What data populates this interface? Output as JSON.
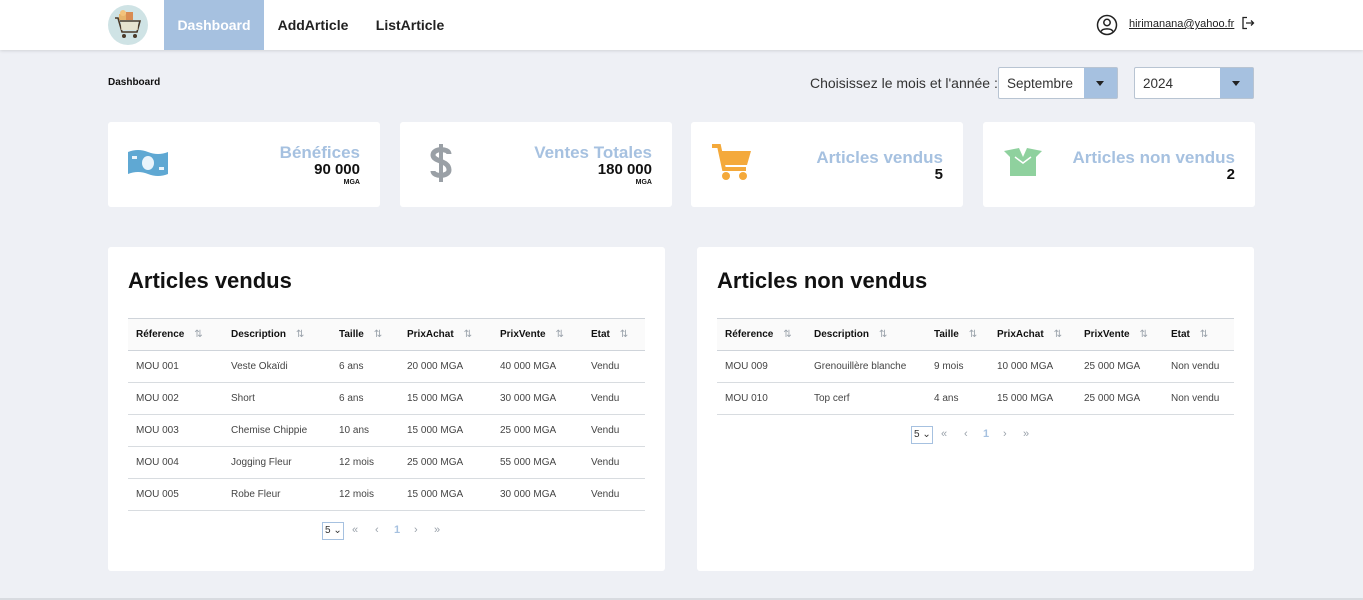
{
  "nav": {
    "items": [
      {
        "label": "Dashboard",
        "active": true
      },
      {
        "label": "AddArticle",
        "active": false
      },
      {
        "label": "ListArticle",
        "active": false
      }
    ],
    "user_email": "hirimanana@yahoo.fr",
    "icons": {
      "user": "user-circle-icon",
      "logout": "logout-icon",
      "logo": "shopping-cart-logo"
    }
  },
  "header": {
    "breadcrumb": "Dashboard",
    "period_label": "Choisissez le mois et l'année :",
    "month": "Septembre",
    "year": "2024"
  },
  "stats": [
    {
      "title": "Bénéfices",
      "value": "90 000",
      "unit": "MGA",
      "icon": "money-bill-icon",
      "icon_color": "#5fa8d3"
    },
    {
      "title": "Ventes Totales",
      "value": "180 000",
      "unit": "MGA",
      "icon": "dollar-icon",
      "icon_color": "#9aa0a6"
    },
    {
      "title": "Articles vendus",
      "value": "5",
      "icon": "shopping-cart-icon",
      "icon_color": "#f4a93b"
    },
    {
      "title": "Articles non vendus",
      "value": "2",
      "icon": "open-box-icon",
      "icon_color": "#8fd19e"
    }
  ],
  "columns": [
    "Réference",
    "Description",
    "Taille",
    "PrixAchat",
    "PrixVente",
    "Etat"
  ],
  "sold": {
    "title": "Articles vendus",
    "rows": [
      [
        "MOU 001",
        "Veste Okaïdi",
        "6 ans",
        "20 000 MGA",
        "40 000 MGA",
        "Vendu"
      ],
      [
        "MOU 002",
        "Short",
        "6 ans",
        "15 000 MGA",
        "30 000 MGA",
        "Vendu"
      ],
      [
        "MOU 003",
        "Chemise Chippie",
        "10 ans",
        "15 000 MGA",
        "25 000 MGA",
        "Vendu"
      ],
      [
        "MOU 004",
        "Jogging Fleur",
        "12 mois",
        "25 000 MGA",
        "55 000 MGA",
        "Vendu"
      ],
      [
        "MOU 005",
        "Robe Fleur",
        "12 mois",
        "15 000 MGA",
        "30 000 MGA",
        "Vendu"
      ]
    ]
  },
  "unsold": {
    "title": "Articles non vendus",
    "rows": [
      [
        "MOU 009",
        "Grenouillère blanche",
        "9 mois",
        "10 000 MGA",
        "25 000 MGA",
        "Non vendu"
      ],
      [
        "MOU 010",
        "Top cerf",
        "4 ans",
        "15 000 MGA",
        "25 000 MGA",
        "Non vendu"
      ]
    ]
  },
  "pager": {
    "page_size": "5",
    "first": "«",
    "prev": "‹",
    "current": "1",
    "next": "›",
    "last": "»"
  },
  "colors": {
    "accent": "#a6c1e0",
    "background": "#eef0f5"
  }
}
